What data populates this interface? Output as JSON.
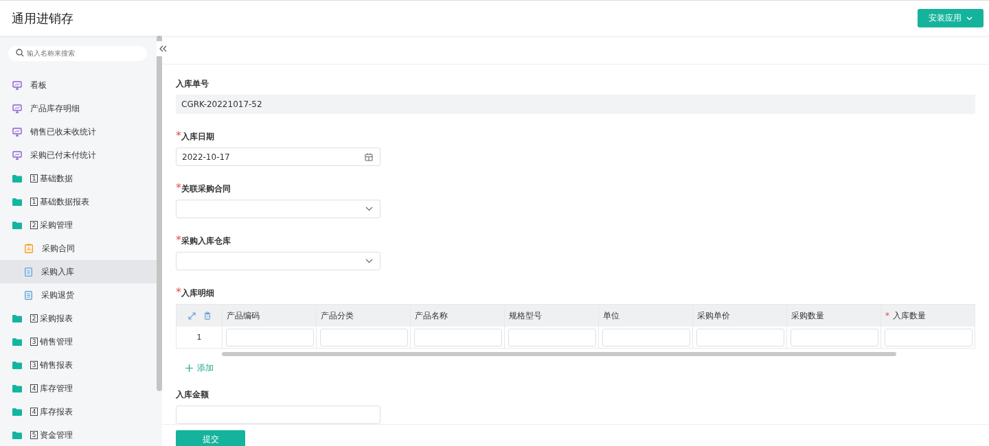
{
  "app": {
    "title": "通用进销存",
    "install_button": "安装应用"
  },
  "sidebar": {
    "search": {
      "placeholder": "输入名称来搜索"
    },
    "items": [
      {
        "kind": "dashboard",
        "label": "看板",
        "selected": false
      },
      {
        "kind": "dashboard",
        "label": "产品库存明细",
        "selected": false
      },
      {
        "kind": "dashboard",
        "label": "销售已收未收统计",
        "selected": false
      },
      {
        "kind": "dashboard",
        "label": "采购已付未付统计",
        "selected": false
      },
      {
        "kind": "folder",
        "number": "1",
        "label": "基础数据",
        "selected": false
      },
      {
        "kind": "folder",
        "number": "1",
        "label": "基础数据报表",
        "selected": false
      },
      {
        "kind": "folder",
        "number": "2",
        "label": "采购管理",
        "selected": false,
        "children": [
          {
            "kind": "contract",
            "label": "采购合同",
            "selected": false
          },
          {
            "kind": "doc",
            "label": "采购入库",
            "selected": true
          },
          {
            "kind": "doc",
            "label": "采购退货",
            "selected": false
          }
        ]
      },
      {
        "kind": "folder",
        "number": "2",
        "label": "采购报表",
        "selected": false
      },
      {
        "kind": "folder",
        "number": "3",
        "label": "销售管理",
        "selected": false
      },
      {
        "kind": "folder",
        "number": "3",
        "label": "销售报表",
        "selected": false
      },
      {
        "kind": "folder",
        "number": "4",
        "label": "库存管理",
        "selected": false
      },
      {
        "kind": "folder",
        "number": "4",
        "label": "库存报表",
        "selected": false
      },
      {
        "kind": "folder",
        "number": "5",
        "label": "资金管理",
        "selected": false
      }
    ]
  },
  "form": {
    "fields": [
      {
        "kind": "readonly",
        "label": "入库单号",
        "value": "CGRK-20221017-52"
      },
      {
        "kind": "date",
        "label": "入库日期",
        "required_mark": "*",
        "value": "2022-10-17"
      },
      {
        "kind": "select",
        "label": "关联采购合同",
        "required_mark": "*"
      },
      {
        "kind": "select",
        "label": "采购入库仓库",
        "required_mark": "*"
      },
      {
        "kind": "table",
        "label": "入库明细",
        "required_mark": "*",
        "columns": [
          {
            "label": "产品编码"
          },
          {
            "label": "产品分类"
          },
          {
            "label": "产品名称"
          },
          {
            "label": "规格型号"
          },
          {
            "label": "单位"
          },
          {
            "label": "采购单价"
          },
          {
            "label": "采购数量"
          },
          {
            "label": "入库数量",
            "required_mark": "*"
          }
        ],
        "rows": [
          {
            "number": "1"
          }
        ],
        "add_label": "添加"
      },
      {
        "kind": "text",
        "label": "入库金额"
      }
    ],
    "submit": "提交"
  }
}
